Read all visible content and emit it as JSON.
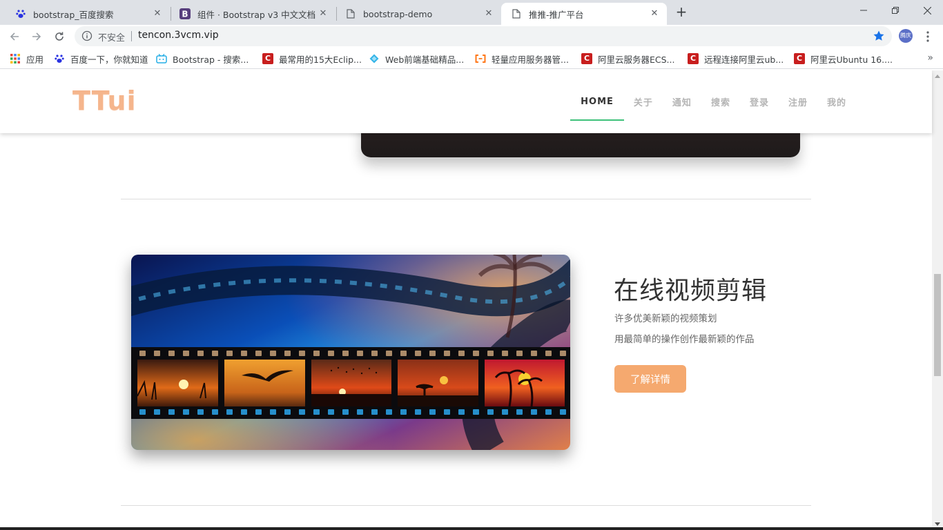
{
  "browser": {
    "tabs": [
      {
        "title": "bootstrap_百度搜索",
        "icon": "baidu-paw-icon",
        "active": false
      },
      {
        "title": "组件 · Bootstrap v3 中文文档",
        "icon": "bootstrap-b-icon",
        "active": false
      },
      {
        "title": "bootstrap-demo",
        "icon": "document-icon",
        "active": false
      },
      {
        "title": "推推-推广平台",
        "icon": "document-icon",
        "active": true
      }
    ],
    "new_tab": "+",
    "tab_close": "✕",
    "security_label": "不安全",
    "url": "tencon.3vcm.vip",
    "profile_initials": "腾庆",
    "bookmarks": [
      {
        "label": "应用",
        "icon": "apps-grid-icon"
      },
      {
        "label": "百度一下，你就知道",
        "icon": "baidu-paw-icon"
      },
      {
        "label": "Bootstrap - 搜索...",
        "icon": "bilibili-tv-icon"
      },
      {
        "label": "最常用的15大Eclip...",
        "icon": "csdn-c-icon"
      },
      {
        "label": "Web前端基础精品...",
        "icon": "diamond-icon"
      },
      {
        "label": "轻量应用服务器管...",
        "icon": "aliyun-bracket-icon"
      },
      {
        "label": "阿里云服务器ECS...",
        "icon": "csdn-c-icon"
      },
      {
        "label": "远程连接阿里云ub...",
        "icon": "csdn-c-icon"
      },
      {
        "label": "阿里云Ubuntu 16....",
        "icon": "csdn-c-icon"
      }
    ],
    "bookmarks_more": "»",
    "colors": {
      "tabstrip": "#dee1e6",
      "star": "#1a73e8",
      "csdn": "#c81e1e"
    }
  },
  "site": {
    "logo": "TTui",
    "nav": [
      "HOME",
      "关于",
      "通知",
      "搜索",
      "登录",
      "注册",
      "我的"
    ],
    "nav_active": "HOME",
    "feature": {
      "title": "在线视频剪辑",
      "lines": [
        "许多优美新颖的视频策划",
        "用最简单的操作创作最新颖的作品"
      ],
      "button": "了解详情"
    },
    "colors": {
      "logo": "#f5b58c",
      "accent": "#3ec17a",
      "button": "#f5a96f"
    }
  }
}
